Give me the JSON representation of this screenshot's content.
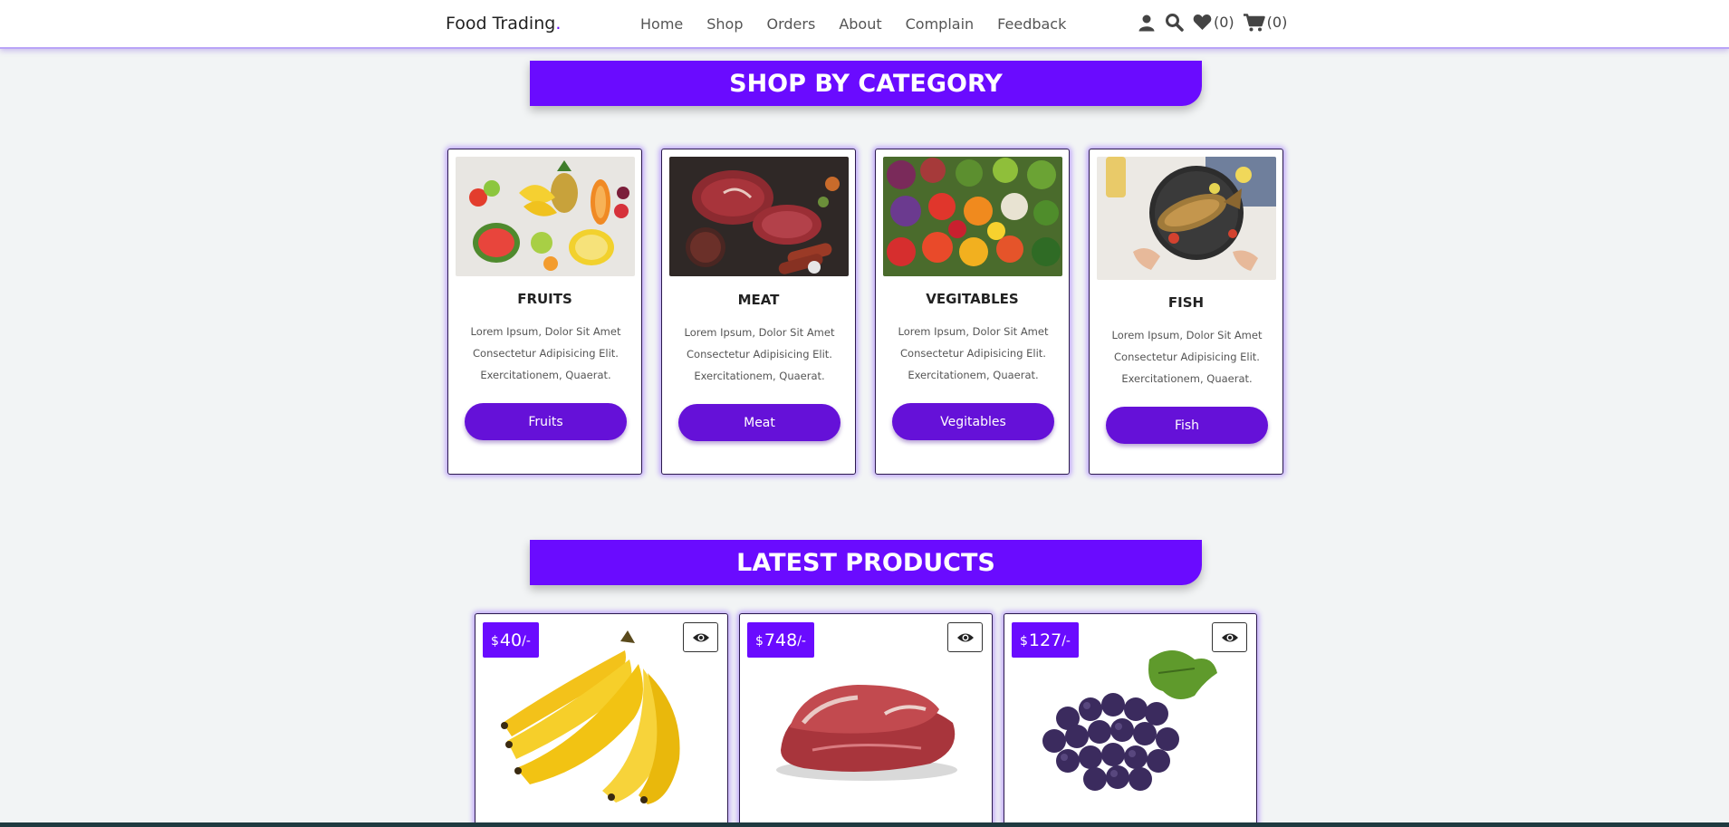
{
  "header": {
    "logo_text": "Food Trading",
    "logo_dot": ".",
    "nav": [
      "Home",
      "Shop",
      "Orders",
      "About",
      "Complain",
      "Feedback"
    ],
    "wishlist_count": "(0)",
    "cart_count": "(0)"
  },
  "category_section": {
    "heading": "SHOP BY CATEGORY",
    "cards": [
      {
        "title": "FRUITS",
        "desc": "Lorem Ipsum, Dolor Sit Amet Consectetur Adipisicing Elit. Exercitationem, Quaerat.",
        "button": "Fruits"
      },
      {
        "title": "MEAT",
        "desc": "Lorem Ipsum, Dolor Sit Amet Consectetur Adipisicing Elit. Exercitationem, Quaerat.",
        "button": "Meat"
      },
      {
        "title": "VEGITABLES",
        "desc": "Lorem Ipsum, Dolor Sit Amet Consectetur Adipisicing Elit. Exercitationem, Quaerat.",
        "button": "Vegitables"
      },
      {
        "title": "FISH",
        "desc": "Lorem Ipsum, Dolor Sit Amet Consectetur Adipisicing Elit. Exercitationem, Quaerat.",
        "button": "Fish"
      }
    ]
  },
  "products_section": {
    "heading": "LATEST PRODUCTS",
    "products": [
      {
        "currency": "$",
        "amount": "40",
        "suffix": "/-",
        "image": "banana"
      },
      {
        "currency": "$",
        "amount": "748",
        "suffix": "/-",
        "image": "meat"
      },
      {
        "currency": "$",
        "amount": "127",
        "suffix": "/-",
        "image": "grapes"
      }
    ]
  },
  "colors": {
    "accent": "#6a0bff",
    "button": "#6511d8"
  }
}
